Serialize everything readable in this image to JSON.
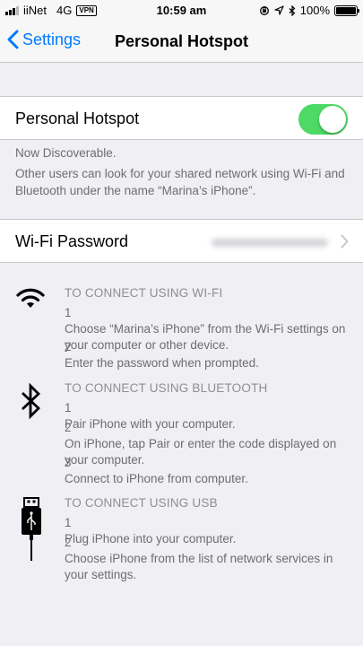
{
  "status_bar": {
    "carrier": "iiNet",
    "network": "4G",
    "vpn": "VPN",
    "time": "10:59 am",
    "battery": "100%"
  },
  "nav": {
    "back_label": "Settings",
    "title": "Personal Hotspot"
  },
  "hotspot": {
    "label": "Personal Hotspot",
    "enabled": true
  },
  "notes": {
    "discoverable": "Now Discoverable.",
    "description": "Other users can look for your shared network using Wi-Fi and Bluetooth under the name “Marina’s iPhone”."
  },
  "password": {
    "label": "Wi-Fi Password"
  },
  "instructions": {
    "wifi": {
      "heading": "TO CONNECT USING WI-FI",
      "steps": [
        {
          "num": "1",
          "text": "Choose “Marina’s iPhone” from the Wi-Fi settings on your computer or other device."
        },
        {
          "num": "2",
          "text": "Enter the password when prompted."
        }
      ]
    },
    "bluetooth": {
      "heading": "TO CONNECT USING BLUETOOTH",
      "steps": [
        {
          "num": "1",
          "text": "Pair iPhone with your computer."
        },
        {
          "num": "2",
          "text": "On iPhone, tap Pair or enter the code displayed on your computer."
        },
        {
          "num": "3",
          "text": "Connect to iPhone from computer."
        }
      ]
    },
    "usb": {
      "heading": "TO CONNECT USING USB",
      "steps": [
        {
          "num": "1",
          "text": "Plug iPhone into your computer."
        },
        {
          "num": "2",
          "text": "Choose iPhone from the list of network services in your settings."
        }
      ]
    }
  },
  "colors": {
    "accent": "#007aff",
    "toggle_on": "#4cd964",
    "background": "#efeff4"
  }
}
